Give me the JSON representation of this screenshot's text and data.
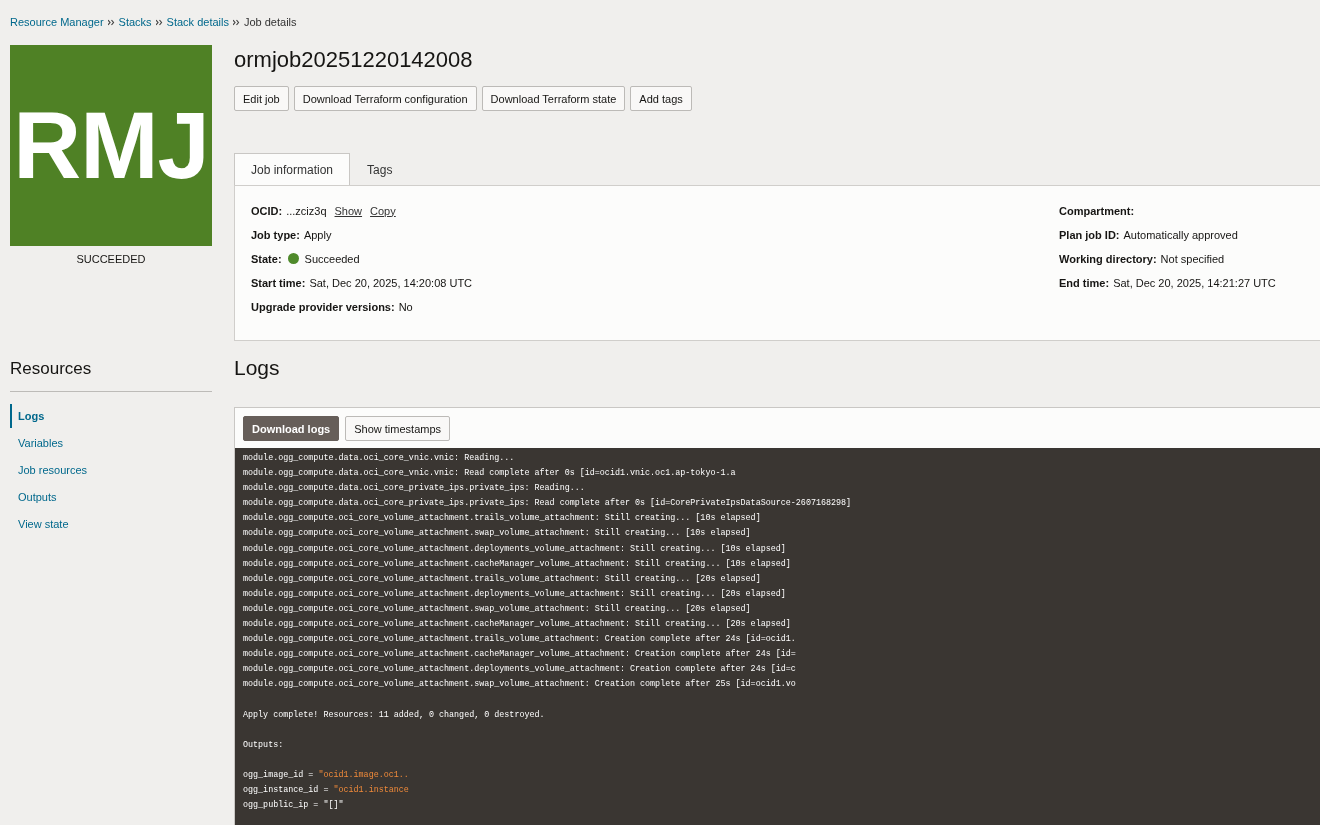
{
  "breadcrumb": [
    {
      "label": "Resource Manager",
      "link": true
    },
    {
      "label": "Stacks",
      "link": true
    },
    {
      "label": "Stack details",
      "link": true
    },
    {
      "label": "Job details",
      "link": false
    }
  ],
  "logo": {
    "text": "RMJ",
    "status": "SUCCEEDED"
  },
  "title": "ormjob20251220142008",
  "actions": [
    "Edit job",
    "Download Terraform configuration",
    "Download Terraform state",
    "Add tags"
  ],
  "tabs": [
    {
      "label": "Job information",
      "selected": true
    },
    {
      "label": "Tags",
      "selected": false
    }
  ],
  "info": {
    "left": [
      {
        "label": "OCID:",
        "value": "...zciz3q",
        "links": [
          "Show",
          "Copy"
        ]
      },
      {
        "label": "Job type:",
        "value": "Apply"
      },
      {
        "label": "State:",
        "value": "Succeeded",
        "color": "#4f8a2b"
      },
      {
        "label": "Start time:",
        "value": "Sat, Dec 20, 2025, 14:20:08 UTC"
      },
      {
        "label": "Upgrade provider versions:",
        "value": "No"
      }
    ],
    "right": [
      {
        "label": "Compartment:"
      },
      {
        "label": "Plan job ID:",
        "value": "Automatically approved"
      },
      {
        "label": "Working directory:",
        "value": "Not specified"
      },
      {
        "label": "End time:",
        "value": "Sat, Dec 20, 2025, 14:21:27 UTC"
      }
    ]
  },
  "resources": {
    "title": "Resources",
    "items": [
      {
        "label": "Logs",
        "selected": true
      },
      {
        "label": "Variables",
        "selected": false
      },
      {
        "label": "Job resources",
        "selected": false
      },
      {
        "label": "Outputs",
        "selected": false
      },
      {
        "label": "View state",
        "selected": false
      }
    ]
  },
  "logs": {
    "title": "Logs",
    "buttons": [
      {
        "label": "Download logs",
        "primary": true
      },
      {
        "label": "Show timestamps",
        "primary": false
      }
    ],
    "lines": [
      {
        "kind": "text",
        "text": "module.ogg_compute.data.oci_core_vnic.vnic: Reading..."
      },
      {
        "kind": "text",
        "text": "module.ogg_compute.data.oci_core_vnic.vnic: Read complete after 0s [id=ocid1.vnic.oc1.ap-tokyo-1.a"
      },
      {
        "kind": "text",
        "text": "module.ogg_compute.data.oci_core_private_ips.private_ips: Reading..."
      },
      {
        "kind": "text",
        "text": "module.ogg_compute.data.oci_core_private_ips.private_ips: Read complete after 0s [id=CorePrivateIpsDataSource-2607168298]"
      },
      {
        "kind": "text",
        "text": "module.ogg_compute.oci_core_volume_attachment.trails_volume_attachment: Still creating... [10s elapsed]"
      },
      {
        "kind": "text",
        "text": "module.ogg_compute.oci_core_volume_attachment.swap_volume_attachment: Still creating... [10s elapsed]"
      },
      {
        "kind": "text",
        "text": "module.ogg_compute.oci_core_volume_attachment.deployments_volume_attachment: Still creating... [10s elapsed]"
      },
      {
        "kind": "text",
        "text": "module.ogg_compute.oci_core_volume_attachment.cacheManager_volume_attachment: Still creating... [10s elapsed]"
      },
      {
        "kind": "text",
        "text": "module.ogg_compute.oci_core_volume_attachment.trails_volume_attachment: Still creating... [20s elapsed]"
      },
      {
        "kind": "text",
        "text": "module.ogg_compute.oci_core_volume_attachment.deployments_volume_attachment: Still creating... [20s elapsed]"
      },
      {
        "kind": "text",
        "text": "module.ogg_compute.oci_core_volume_attachment.swap_volume_attachment: Still creating... [20s elapsed]"
      },
      {
        "kind": "text",
        "text": "module.ogg_compute.oci_core_volume_attachment.cacheManager_volume_attachment: Still creating... [20s elapsed]"
      },
      {
        "kind": "text",
        "text": "module.ogg_compute.oci_core_volume_attachment.trails_volume_attachment: Creation complete after 24s [id=ocid1."
      },
      {
        "kind": "text",
        "text": "module.ogg_compute.oci_core_volume_attachment.cacheManager_volume_attachment: Creation complete after 24s [id="
      },
      {
        "kind": "text",
        "text": "module.ogg_compute.oci_core_volume_attachment.deployments_volume_attachment: Creation complete after 24s [id=c"
      },
      {
        "kind": "text",
        "text": "module.ogg_compute.oci_core_volume_attachment.swap_volume_attachment: Creation complete after 25s [id=ocid1.vo"
      },
      {
        "kind": "blank"
      },
      {
        "kind": "text",
        "text": "Apply complete! Resources: 11 added, 0 changed, 0 destroyed."
      },
      {
        "kind": "blank"
      },
      {
        "kind": "text",
        "text": "Outputs:"
      },
      {
        "kind": "blank"
      },
      {
        "kind": "output",
        "key": "ogg_image_id = ",
        "value": "\"ocid1.image.oc1.."
      },
      {
        "kind": "output",
        "key": "ogg_instance_id = ",
        "value": "\"ocid1.instance"
      },
      {
        "kind": "text",
        "text": "ogg_public_ip = \"[]\""
      }
    ]
  }
}
